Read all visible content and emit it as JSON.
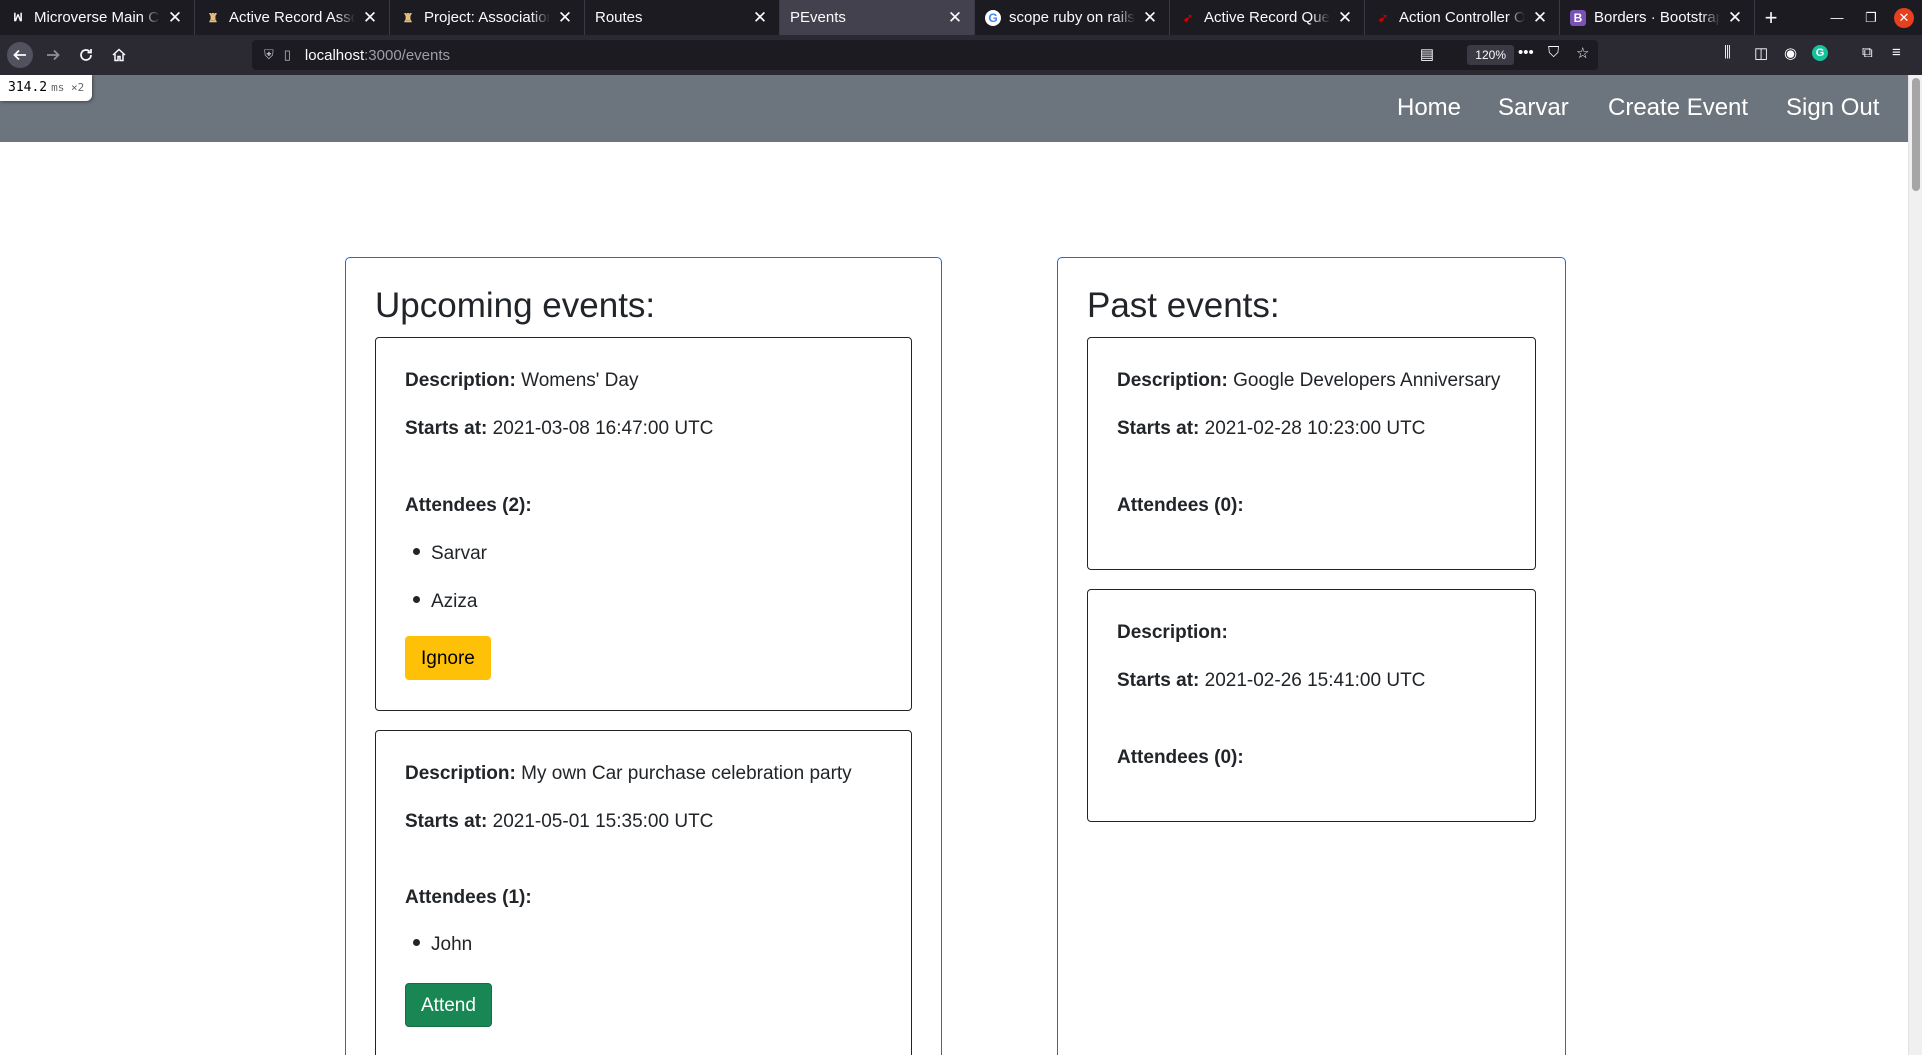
{
  "browser": {
    "tabs": [
      {
        "title": "Microverse Main Cu",
        "favicon": "microverse-icon"
      },
      {
        "title": "Active Record Assoc",
        "favicon": "rails-guide-icon"
      },
      {
        "title": "Project: Associations",
        "favicon": "odin-icon"
      },
      {
        "title": "Routes",
        "favicon": ""
      },
      {
        "title": "PEvents",
        "favicon": ""
      },
      {
        "title": "scope ruby on rails g",
        "favicon": "google-icon"
      },
      {
        "title": "Active Record Query",
        "favicon": "rails-icon"
      },
      {
        "title": "Action Controller Ov",
        "favicon": "rails-icon"
      },
      {
        "title": "Borders · Bootstrap",
        "favicon": "bootstrap-icon"
      }
    ],
    "active_tab_index": 4,
    "url_host": "localhost",
    "url_path": ":3000/events",
    "zoom": "120%"
  },
  "profiler": {
    "value": "314.2",
    "unit": "ms ×2"
  },
  "site_nav": {
    "home": "Home",
    "user": "Sarvar",
    "create_event": "Create Event",
    "sign_out": "Sign Out"
  },
  "labels": {
    "description": "Description:",
    "starts_at": "Starts at:"
  },
  "upcoming": {
    "heading": "Upcoming events:",
    "events": [
      {
        "description": "Womens' Day",
        "starts_at": "2021-03-08 16:47:00 UTC",
        "attendees_label": "Attendees (2):",
        "attendees": [
          "Sarvar",
          "Aziza"
        ],
        "action": "Ignore"
      },
      {
        "description": "My own Car purchase celebration party",
        "starts_at": "2021-05-01 15:35:00 UTC",
        "attendees_label": "Attendees (1):",
        "attendees": [
          "John"
        ],
        "action": "Attend"
      }
    ]
  },
  "past": {
    "heading": "Past events:",
    "events": [
      {
        "description": "Google Developers Anniversary",
        "starts_at": "2021-02-28 10:23:00 UTC",
        "attendees_label": "Attendees (0):"
      },
      {
        "description": "",
        "starts_at": "2021-02-26 15:41:00 UTC",
        "attendees_label": "Attendees (0):"
      }
    ]
  },
  "colors": {
    "nav_bg": "#6c757d",
    "column_border": "#0d6efd",
    "ignore_button": "#ffc107",
    "attend_button": "#198754"
  }
}
